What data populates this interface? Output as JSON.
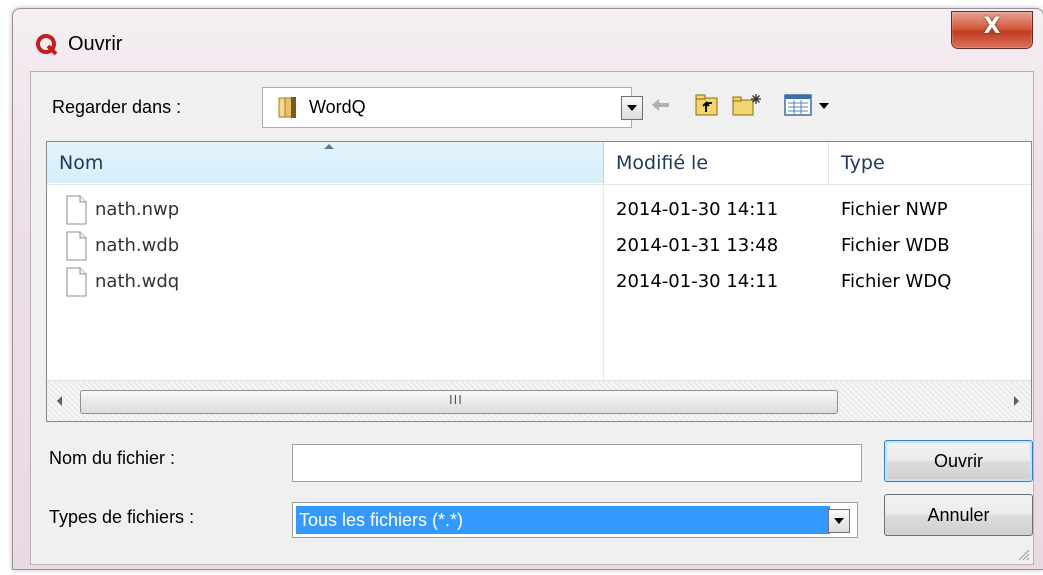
{
  "window": {
    "title": "Ouvrir",
    "close_label": "X"
  },
  "toolbar": {
    "look_in_label": "Regarder dans :",
    "look_in_value": "WordQ"
  },
  "file_list": {
    "columns": [
      "Nom",
      "Modifié le",
      "Type"
    ],
    "rows": [
      {
        "name": "nath.nwp",
        "modified": "2014-01-30 14:11",
        "type": "Fichier NWP"
      },
      {
        "name": "nath.wdb",
        "modified": "2014-01-31 13:48",
        "type": "Fichier WDB"
      },
      {
        "name": "nath.wdq",
        "modified": "2014-01-30 14:11",
        "type": "Fichier WDQ"
      }
    ],
    "scroll_thumb_grip": "III"
  },
  "form": {
    "filename_label": "Nom du fichier :",
    "filename_value": "",
    "filetypes_label": "Types de fichiers :",
    "filetypes_value": "Tous les fichiers (*.*)"
  },
  "buttons": {
    "open": "Ouvrir",
    "cancel": "Annuler"
  },
  "colors": {
    "selection": "#3399ff",
    "close_button": "#c8452a",
    "header_highlight": "#dff2fb"
  },
  "icons": {
    "title": "app-q-icon",
    "folder": "folder-icon",
    "back": "back-arrow-icon",
    "up": "up-folder-icon",
    "new_folder": "new-folder-icon",
    "view_menu": "view-menu-icon",
    "file": "file-icon"
  }
}
